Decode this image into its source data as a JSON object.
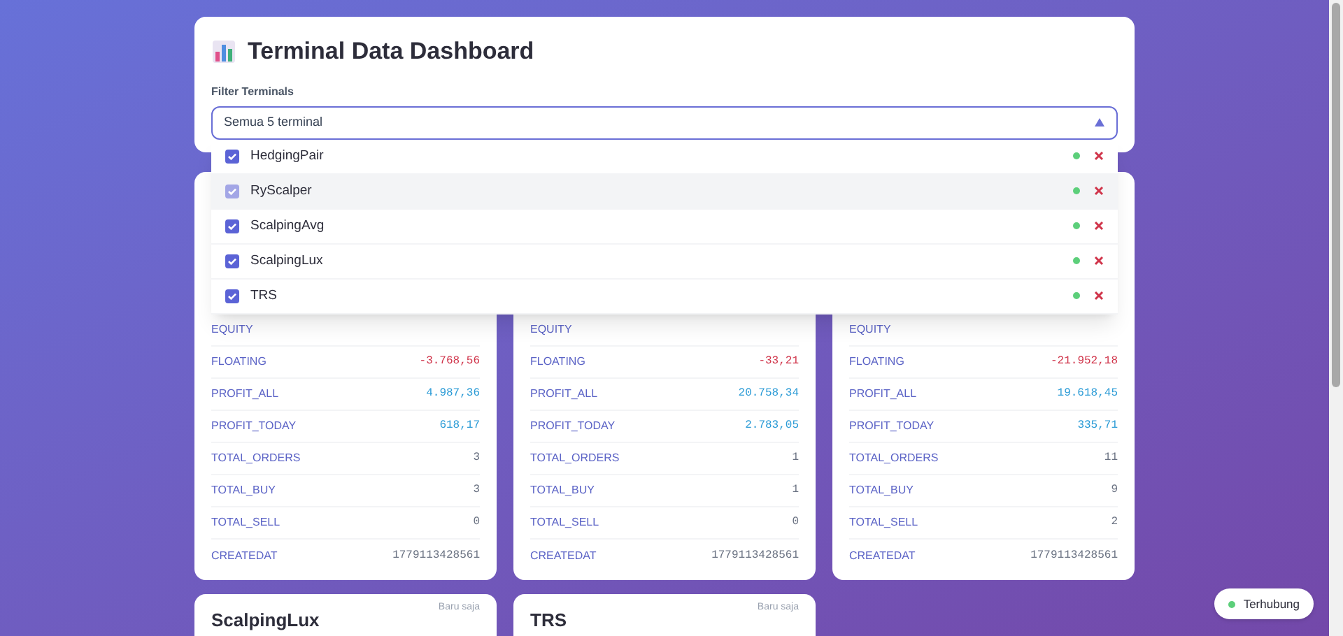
{
  "header": {
    "title": "Terminal Data Dashboard",
    "filter_label": "Filter Terminals",
    "filter_value": "Semua 5 terminal",
    "expanded": true
  },
  "terminals": [
    {
      "name": "HedgingPair",
      "checked": true,
      "highlighted": false,
      "online": true
    },
    {
      "name": "RyScalper",
      "checked": true,
      "highlighted": true,
      "online": true
    },
    {
      "name": "ScalpingAvg",
      "checked": true,
      "highlighted": false,
      "online": true
    },
    {
      "name": "ScalpingLux",
      "checked": true,
      "highlighted": false,
      "online": true
    },
    {
      "name": "TRS",
      "checked": true,
      "highlighted": false,
      "online": true
    }
  ],
  "cards": [
    {
      "rows": [
        {
          "label": "EQUITY"
        },
        {
          "label": "FLOATING",
          "value": "-3.768,56",
          "kind": "loss"
        },
        {
          "label": "PROFIT_ALL",
          "value": "4.987,36",
          "kind": "profit"
        },
        {
          "label": "PROFIT_TODAY",
          "value": "618,17",
          "kind": "profit"
        },
        {
          "label": "TOTAL_ORDERS",
          "value": "3",
          "kind": "neutral"
        },
        {
          "label": "TOTAL_BUY",
          "value": "3",
          "kind": "neutral"
        },
        {
          "label": "TOTAL_SELL",
          "value": "0",
          "kind": "neutral"
        },
        {
          "label": "CREATEDAT",
          "value": "1779113428561",
          "kind": "neutral"
        }
      ]
    },
    {
      "rows": [
        {
          "label": "EQUITY"
        },
        {
          "label": "FLOATING",
          "value": "-33,21",
          "kind": "loss"
        },
        {
          "label": "PROFIT_ALL",
          "value": "20.758,34",
          "kind": "profit"
        },
        {
          "label": "PROFIT_TODAY",
          "value": "2.783,05",
          "kind": "profit"
        },
        {
          "label": "TOTAL_ORDERS",
          "value": "1",
          "kind": "neutral"
        },
        {
          "label": "TOTAL_BUY",
          "value": "1",
          "kind": "neutral"
        },
        {
          "label": "TOTAL_SELL",
          "value": "0",
          "kind": "neutral"
        },
        {
          "label": "CREATEDAT",
          "value": "1779113428561",
          "kind": "neutral"
        }
      ]
    },
    {
      "rows": [
        {
          "label": "EQUITY"
        },
        {
          "label": "FLOATING",
          "value": "-21.952,18",
          "kind": "loss"
        },
        {
          "label": "PROFIT_ALL",
          "value": "19.618,45",
          "kind": "profit"
        },
        {
          "label": "PROFIT_TODAY",
          "value": "335,71",
          "kind": "profit"
        },
        {
          "label": "TOTAL_ORDERS",
          "value": "11",
          "kind": "neutral"
        },
        {
          "label": "TOTAL_BUY",
          "value": "9",
          "kind": "neutral"
        },
        {
          "label": "TOTAL_SELL",
          "value": "2",
          "kind": "neutral"
        },
        {
          "label": "CREATEDAT",
          "value": "1779113428561",
          "kind": "neutral"
        }
      ]
    }
  ],
  "bottom_cards": [
    {
      "name": "ScalpingLux",
      "updated": "Baru saja"
    },
    {
      "name": "TRS",
      "updated": "Baru saja"
    }
  ],
  "status": {
    "label": "Terhubung",
    "connected": true
  }
}
